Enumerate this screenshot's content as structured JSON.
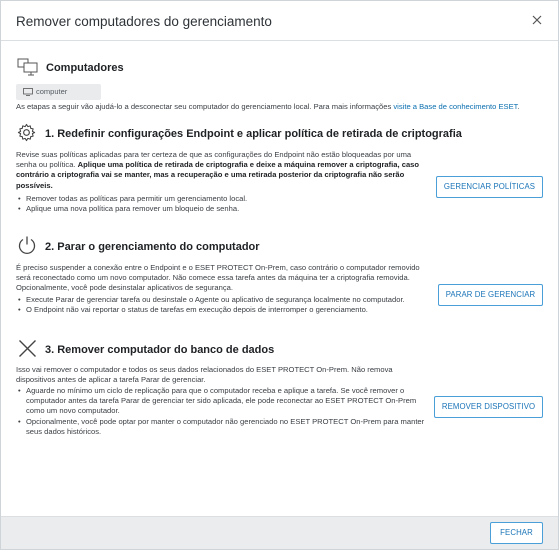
{
  "dialog": {
    "title": "Remover computadores do gerenciamento",
    "close_icon": "close-icon"
  },
  "computers": {
    "heading": "Computadores",
    "icon": "computers-icon",
    "chip_label": "computer",
    "intro_text": "As etapas a seguir vão ajudá-lo a desconectar seu computador do gerenciamento local. Para mais informações ",
    "intro_link": "visite a Base de conhecimento ESET",
    "intro_end": "."
  },
  "step1": {
    "heading": "1. Redefinir configurações Endpoint e aplicar política de retirada de criptografia",
    "icon": "gear-icon",
    "text_plain": "Revise suas políticas aplicadas para ter certeza de que as configurações do Endpoint não estão bloqueadas por uma senha ou política. ",
    "text_bold": "Aplique uma política de retirada de criptografia e deixe a máquina remover a criptografia, caso contrário a criptografia vai se manter, mas a recuperação e uma retirada posterior da criptografia não serão possíveis.",
    "bullets": [
      "Remover todas as políticas para permitir um gerenciamento local.",
      "Aplique uma nova política para remover um bloqueio de senha."
    ],
    "button_label": "GERENCIAR POLÍTICAS"
  },
  "step2": {
    "heading": "2. Parar o gerenciamento do computador",
    "icon": "power-icon",
    "text": "É preciso suspender a conexão entre o Endpoint e o ESET PROTECT On-Prem, caso contrário o computador removido será reconectado como um novo computador. Não comece essa tarefa antes da máquina ter a criptografia removida. Opcionalmente, você pode desinstalar aplicativos de segurança.",
    "bullets": [
      "Execute Parar de gerenciar tarefa ou desinstale o Agente ou aplicativo de segurança localmente no computador.",
      "O Endpoint não vai reportar o status de tarefas em execução depois de interromper o gerenciamento."
    ],
    "button_label": "PARAR DE GERENCIAR"
  },
  "step3": {
    "heading": "3. Remover computador do banco de dados",
    "icon": "remove-x-icon",
    "text": "Isso vai remover o computador e todos os seus dados relacionados do ESET PROTECT On-Prem. Não remova dispositivos antes de aplicar a tarefa Parar de gerenciar.",
    "bullets": [
      "Aguarde no mínimo um ciclo de replicação para que o computador receba e aplique a tarefa. Se você remover o computador antes da tarefa Parar de gerenciar ter sido aplicada, ele pode reconectar ao ESET PROTECT On-Prem como um novo computador.",
      "Opcionalmente, você pode optar por manter o computador não gerenciado no ESET PROTECT On-Prem para manter seus dados históricos."
    ],
    "button_label": "REMOVER DISPOSITIVO"
  },
  "footer": {
    "close_label": "FECHAR"
  },
  "colors": {
    "accent": "#1a74b8",
    "button_border": "#4a9fd8",
    "link": "#0b6fb0",
    "footer_bg": "#eaecee"
  }
}
